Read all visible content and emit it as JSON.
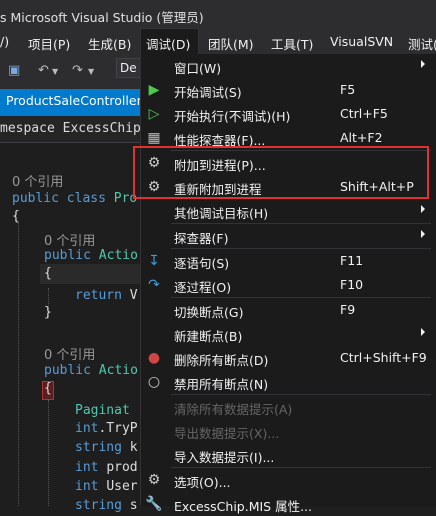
{
  "window": {
    "title": "s Microsoft Visual Studio (管理员)"
  },
  "menubar": {
    "items": [
      "/)",
      "项目(P)",
      "生成(B)",
      "调试(D)",
      "团队(M)",
      "工具(T)",
      "VisualSVN",
      "测试(S)"
    ]
  },
  "toolbar": {
    "config_combo": "De"
  },
  "tab": {
    "label": "ProductSaleController.cs"
  },
  "navbar": {
    "namespace": "mespace ExcessChip."
  },
  "code": {
    "ref0": "0 个引用",
    "class_kw": "public class",
    "class_name": "Pro",
    "brace0": "{",
    "ref1": "0 个引用",
    "m1_kw": "public",
    "m1_type": "Actio",
    "brace1": "{",
    "ret_kw": "return",
    "ret_val": "V",
    "brace1_close": "}",
    "ref2": "0 个引用",
    "m2_kw": "public",
    "m2_type": "Actio",
    "brace2": "{",
    "l1": "Paginat",
    "l2_kw": "int",
    "l2": ".TryP",
    "l3_kw": "string",
    "l3": "k",
    "l4_kw": "int",
    "l4": "prod",
    "l5_kw": "int",
    "l5": "User",
    "l6_kw": "string",
    "l6": "s"
  },
  "debug_menu": {
    "items": [
      {
        "label": "窗口(W)",
        "shortcut": "",
        "icon": "none",
        "submenu": true,
        "disabled": false
      },
      {
        "label": "开始调试(S)",
        "shortcut": "F5",
        "icon": "start-debug-icon",
        "submenu": false,
        "disabled": false
      },
      {
        "label": "开始执行(不调试)(H)",
        "shortcut": "Ctrl+F5",
        "icon": "start-nodebug-icon",
        "submenu": false,
        "disabled": false
      },
      {
        "label": "性能探查器(F)...",
        "shortcut": "Alt+F2",
        "icon": "profiler-icon",
        "submenu": false,
        "disabled": false
      },
      {
        "label": "附加到进程(P)...",
        "shortcut": "",
        "icon": "attach-process-icon",
        "submenu": false,
        "disabled": false
      },
      {
        "label": "重新附加到进程",
        "shortcut": "Shift+Alt+P",
        "icon": "reattach-process-icon",
        "submenu": false,
        "disabled": false
      },
      {
        "label": "其他调试目标(H)",
        "shortcut": "",
        "icon": "none",
        "submenu": true,
        "disabled": false
      },
      {
        "label": "探查器(F)",
        "shortcut": "",
        "icon": "none",
        "submenu": true,
        "disabled": false
      },
      {
        "label": "逐语句(S)",
        "shortcut": "F11",
        "icon": "step-into-icon",
        "submenu": false,
        "disabled": false
      },
      {
        "label": "逐过程(O)",
        "shortcut": "F10",
        "icon": "step-over-icon",
        "submenu": false,
        "disabled": false
      },
      {
        "label": "切换断点(G)",
        "shortcut": "F9",
        "icon": "none",
        "submenu": false,
        "disabled": false
      },
      {
        "label": "新建断点(B)",
        "shortcut": "",
        "icon": "none",
        "submenu": true,
        "disabled": false
      },
      {
        "label": "删除所有断点(D)",
        "shortcut": "Ctrl+Shift+F9",
        "icon": "delete-breakpoints-icon",
        "submenu": false,
        "disabled": false
      },
      {
        "label": "禁用所有断点(N)",
        "shortcut": "",
        "icon": "disable-breakpoints-icon",
        "submenu": false,
        "disabled": false
      },
      {
        "label": "清除所有数据提示(A)",
        "shortcut": "",
        "icon": "none",
        "submenu": false,
        "disabled": true
      },
      {
        "label": "导出数据提示(X)...",
        "shortcut": "",
        "icon": "none",
        "submenu": false,
        "disabled": true
      },
      {
        "label": "导入数据提示(I)...",
        "shortcut": "",
        "icon": "none",
        "submenu": false,
        "disabled": false
      },
      {
        "label": "选项(O)...",
        "shortcut": "",
        "icon": "gear-icon",
        "submenu": false,
        "disabled": false
      },
      {
        "label": "ExcessChip.MIS 属性...",
        "shortcut": "",
        "icon": "wrench-icon",
        "submenu": false,
        "disabled": false
      }
    ]
  },
  "colors": {
    "accent": "#007acc",
    "highlight": "#e0302f",
    "menu_bg": "#1b1b1c",
    "play_green": "#4ec94e",
    "step_blue": "#3c9cdc"
  }
}
